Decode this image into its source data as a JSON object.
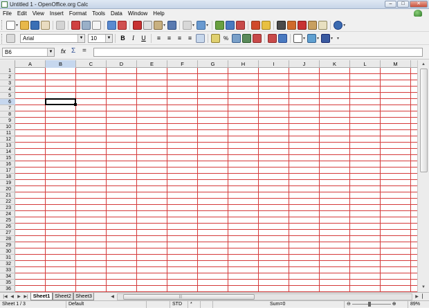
{
  "window": {
    "title": "Untitled 1 - OpenOffice.org Calc"
  },
  "menu": [
    "File",
    "Edit",
    "View",
    "Insert",
    "Format",
    "Tools",
    "Data",
    "Window",
    "Help"
  ],
  "format_toolbar": {
    "font_name": "Arial",
    "font_size": "10"
  },
  "formula_bar": {
    "name_box": "B6",
    "formula": ""
  },
  "columns": [
    "A",
    "B",
    "C",
    "D",
    "E",
    "F",
    "G",
    "H",
    "I",
    "J",
    "K",
    "L",
    "M"
  ],
  "rows": [
    "1",
    "2",
    "3",
    "4",
    "5",
    "6",
    "7",
    "8",
    "9",
    "10",
    "11",
    "12",
    "13",
    "14",
    "15",
    "16",
    "17",
    "18",
    "19",
    "20",
    "21",
    "22",
    "23",
    "24",
    "25",
    "26",
    "27",
    "28",
    "29",
    "30",
    "31",
    "32",
    "33",
    "34",
    "35",
    "36"
  ],
  "active_cell": {
    "column": "B",
    "row": "6"
  },
  "sheet_tabs": [
    "Sheet1",
    "Sheet2",
    "Sheet3"
  ],
  "active_sheet": "Sheet1",
  "status": {
    "sheet": "Sheet 1 / 3",
    "page_style": "Default",
    "mode": "STD",
    "modified": "*",
    "sum": "Sum=0",
    "zoom": "89%"
  },
  "colors": {
    "gridline": "#d43a3a",
    "selection_header": "#c6d7ee"
  }
}
